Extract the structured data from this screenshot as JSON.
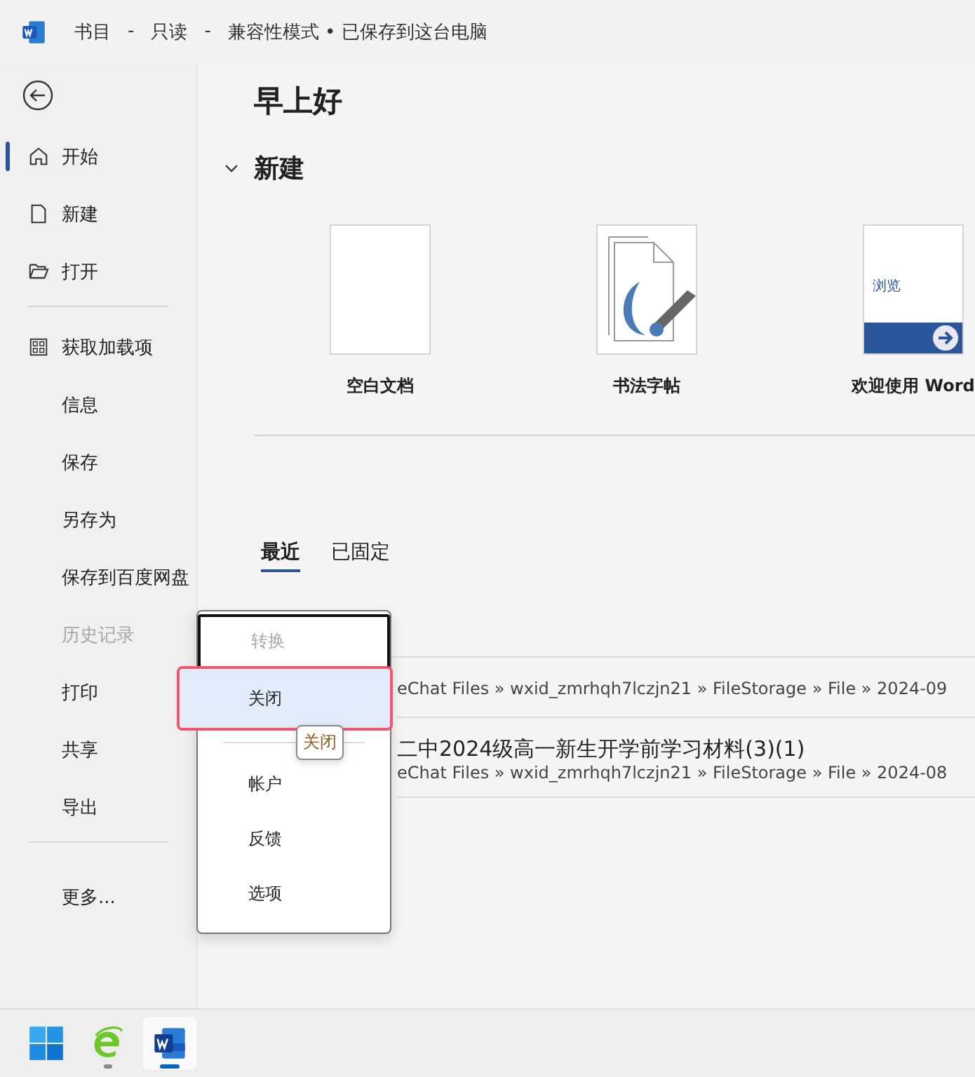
{
  "window": {
    "title_parts": [
      "书目",
      "-",
      "只读",
      "-",
      "兼容性模式 • 已保存到这台电脑"
    ]
  },
  "sidebar": {
    "items": [
      {
        "label": "开始",
        "kind": "home",
        "selected": true,
        "disabled": false,
        "divider_after": false
      },
      {
        "label": "新建",
        "kind": "doc",
        "selected": false,
        "disabled": false,
        "divider_after": false
      },
      {
        "label": "打开",
        "kind": "folder",
        "selected": false,
        "disabled": false,
        "divider_after": true
      },
      {
        "label": "获取加载项",
        "kind": "grid",
        "selected": false,
        "disabled": false,
        "divider_after": false
      },
      {
        "label": "信息",
        "kind": "plain",
        "selected": false,
        "disabled": false,
        "divider_after": false
      },
      {
        "label": "保存",
        "kind": "plain",
        "selected": false,
        "disabled": false,
        "divider_after": false
      },
      {
        "label": "另存为",
        "kind": "plain",
        "selected": false,
        "disabled": false,
        "divider_after": false
      },
      {
        "label": "保存到百度网盘",
        "kind": "plain",
        "selected": false,
        "disabled": false,
        "divider_after": false
      },
      {
        "label": "历史记录",
        "kind": "plain",
        "selected": false,
        "disabled": true,
        "divider_after": false
      },
      {
        "label": "打印",
        "kind": "plain",
        "selected": false,
        "disabled": false,
        "divider_after": false
      },
      {
        "label": "共享",
        "kind": "plain",
        "selected": false,
        "disabled": false,
        "divider_after": false
      },
      {
        "label": "导出",
        "kind": "plain",
        "selected": false,
        "disabled": false,
        "divider_after": true
      },
      {
        "label": "更多...",
        "kind": "plain",
        "selected": false,
        "disabled": false,
        "divider_after": false
      }
    ]
  },
  "greeting": "早上好",
  "new_section": {
    "title": "新建",
    "expanded": true,
    "templates": [
      {
        "label": "空白文档",
        "kind": "blank"
      },
      {
        "label": "书法字帖",
        "kind": "calligraphy"
      },
      {
        "label": "欢迎使用 Word",
        "kind": "welcome",
        "thumb_text": "浏览"
      }
    ]
  },
  "recent": {
    "tabs": [
      {
        "label": "最近",
        "selected": true
      },
      {
        "label": "已固定",
        "selected": false
      }
    ],
    "files": [
      {
        "path": "eChat Files » wxid_zmrhqh7lczjn21 » FileStorage » File » 2024-09"
      },
      {
        "name": "二中2024级高一新生开学前学习材料(3)(1)",
        "path": "eChat Files » wxid_zmrhqh7lczjn21 » FileStorage » File » 2024-08"
      }
    ]
  },
  "context_menu": {
    "items": [
      {
        "kind": "item",
        "label": "转换",
        "disabled": true,
        "selected": false,
        "focused": true
      },
      {
        "kind": "item",
        "label": "关闭",
        "disabled": false,
        "selected": true,
        "focused": false
      },
      {
        "kind": "divider"
      },
      {
        "kind": "item",
        "label": "帐户",
        "disabled": false,
        "selected": false,
        "focused": false
      },
      {
        "kind": "item",
        "label": "反馈",
        "disabled": false,
        "selected": false,
        "focused": false
      },
      {
        "kind": "item",
        "label": "选项",
        "disabled": false,
        "selected": false,
        "focused": false
      }
    ],
    "tooltip": "关闭"
  },
  "taskbar": {
    "apps": [
      {
        "kind": "start",
        "active": false
      },
      {
        "kind": "browser",
        "active": false
      },
      {
        "kind": "word",
        "active": true
      }
    ]
  }
}
